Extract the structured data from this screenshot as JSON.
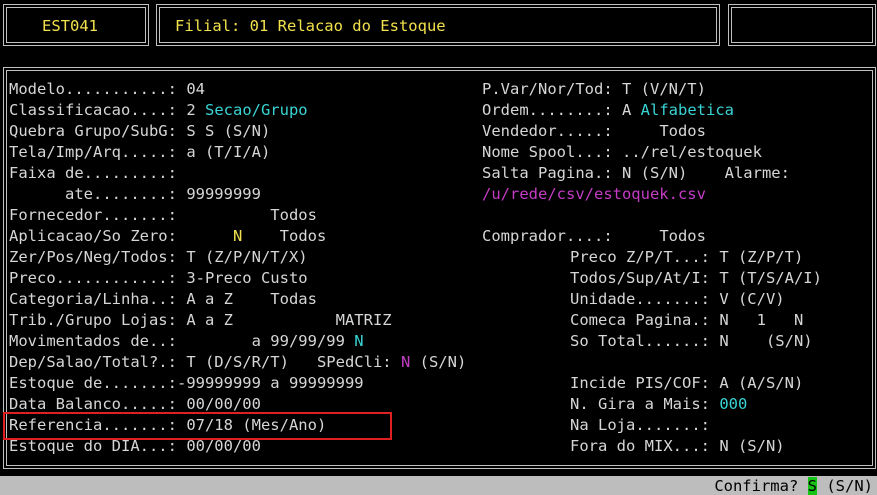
{
  "header": {
    "program": "EST041",
    "title": "Filial: 01 Relacao do Estoque"
  },
  "left": [
    {
      "label": "Modelo...........:",
      "value": " 04"
    },
    {
      "label": "Classificacao....:",
      "value": " 2",
      "extra": " Secao/Grupo"
    },
    {
      "label": "Quebra Grupo/SubG:",
      "value": " S S (S/N)"
    },
    {
      "label": "Tela/Imp/Arq.....:",
      "value": " a (T/I/A)"
    },
    {
      "label": "Faixa de.........:",
      "value": ""
    },
    {
      "label": "      ate........:",
      "value": " 99999999"
    },
    {
      "label": "Fornecedor.......:",
      "value": "          Todos"
    },
    {
      "label": "Aplicacao/So Zero:",
      "value": "      ",
      "extra_y": "N",
      "value2": "    Todos"
    },
    {
      "label": "Zer/Pos/Neg/Todos:",
      "value": " T (Z/P/N/T/X)"
    },
    {
      "label": "Preco............:",
      "value": " 3-Preco Custo"
    },
    {
      "label": "Categoria/Linha..:",
      "value": " A a Z    Todas"
    },
    {
      "label": "Trib./Grupo Lojas:",
      "value": " A a Z           MATRIZ"
    },
    {
      "label": "Movimentados de..:",
      "value": "        a 99/99/99",
      "extra": " N"
    },
    {
      "label": "Dep/Salao/Total?.:",
      "value": " T (D/S/R/T)   SPedCli:",
      "extra_m": " N",
      "value2": " (S/N)"
    },
    {
      "label": "Estoque de.......:",
      "value": "-99999999 a 99999999"
    },
    {
      "label": "Data Balanco.....:",
      "value": " 00/00/00"
    },
    {
      "label": "Referencia.......:",
      "value": " 07/18 (Mes/Ano)"
    },
    {
      "label": "Estoque do DIA...:",
      "value": " 00/00/00"
    }
  ],
  "right_top": [
    {
      "label": "P.Var/Nor/Tod:",
      "value": " T (V/N/T)"
    },
    {
      "label": "Ordem........:",
      "value": " A",
      "extra": " Alfabetica"
    },
    {
      "label": "Vendedor.....:",
      "value": "     Todos"
    },
    {
      "label": "Nome Spool...:",
      "value": " ../rel/estoquek"
    },
    {
      "label": "Salta Pagina.:",
      "value": " N (S/N)    Alarme:"
    },
    {
      "label": "",
      "value": "",
      "extra_m": "/u/rede/csv/estoquek.csv"
    },
    {
      "label": "Comprador....:",
      "value": "     Todos"
    }
  ],
  "right_bottom": [
    {
      "label": "Preco Z/P/T...:",
      "value": " T (Z/P/T)"
    },
    {
      "label": "Todos/Sup/At/I:",
      "value": " T (T/S/A/I)"
    },
    {
      "label": "Unidade.......:",
      "value": " V (C/V)"
    },
    {
      "label": "Comeca Pagina.:",
      "value": " N   1   N"
    },
    {
      "label": "So Total......:",
      "value": " N    (S/N)"
    },
    {
      "label": "Incide PIS/COF:",
      "value": " A (A/S/N)"
    },
    {
      "label": "N. Gira a Mais:",
      "value": " ",
      "extra": "000"
    },
    {
      "label": "Na Loja.......:",
      "value": ""
    },
    {
      "label": "Fora do MIX...:",
      "value": " N (S/N)"
    }
  ],
  "status": {
    "prompt": "Confirma?",
    "answer": "S",
    "options": " (S/N)"
  },
  "colors": {
    "label": "#d6d6d6",
    "highlight_yellow": "#f2e14c",
    "cyan": "#38d4d4",
    "magenta": "#c43cc4",
    "selection_box": "#e02020"
  }
}
